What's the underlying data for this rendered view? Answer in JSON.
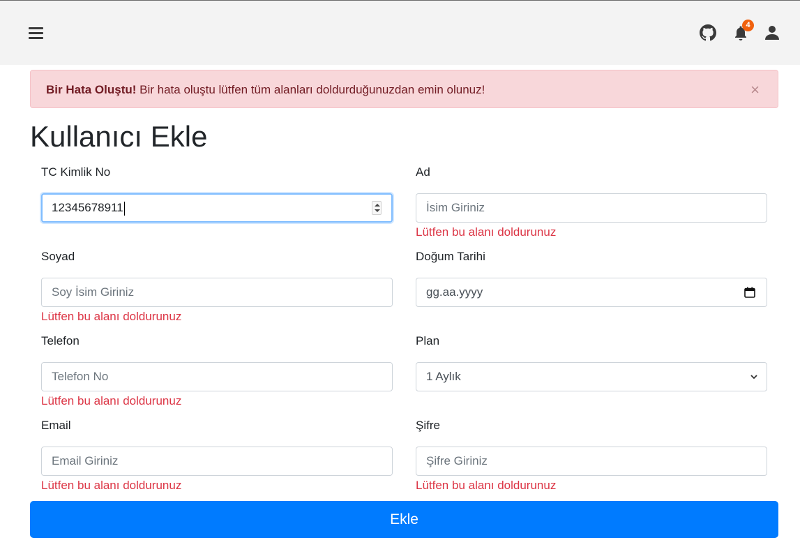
{
  "header": {
    "notification_count": "4",
    "icons": [
      "menu-icon",
      "github-icon",
      "bell-icon",
      "user-icon"
    ]
  },
  "alert": {
    "title": "Bir Hata Oluştu!",
    "message": " Bir hata oluştu lütfen tüm alanları doldurduğunuzdan emin olunuz!",
    "close": "×"
  },
  "page_title": "Kullanıcı Ekle",
  "form": {
    "tc": {
      "label": "TC Kimlik No",
      "value": "12345678911"
    },
    "ad": {
      "label": "Ad",
      "placeholder": "İsim Giriniz",
      "error": "Lütfen bu alanı doldurunuz"
    },
    "soyad": {
      "label": "Soyad",
      "placeholder": "Soy İsim Giriniz",
      "error": "Lütfen bu alanı doldurunuz"
    },
    "dogum": {
      "label": "Doğum Tarihi",
      "placeholder": "gg.aa.yyyy"
    },
    "telefon": {
      "label": "Telefon",
      "placeholder": "Telefon No",
      "error": "Lütfen bu alanı doldurunuz"
    },
    "plan": {
      "label": "Plan",
      "selected": "1 Aylık"
    },
    "email": {
      "label": "Email",
      "placeholder": "Email Giriniz",
      "error": "Lütfen bu alanı doldurunuz"
    },
    "sifre": {
      "label": "Şifre",
      "placeholder": "Şifre Giriniz",
      "error": "Lütfen bu alanı doldurunuz"
    }
  },
  "submit_label": "Ekle",
  "colors": {
    "primary": "#007bff",
    "error": "#dc3545",
    "alert_bg": "#f8d7da",
    "badge": "#f0610e"
  }
}
